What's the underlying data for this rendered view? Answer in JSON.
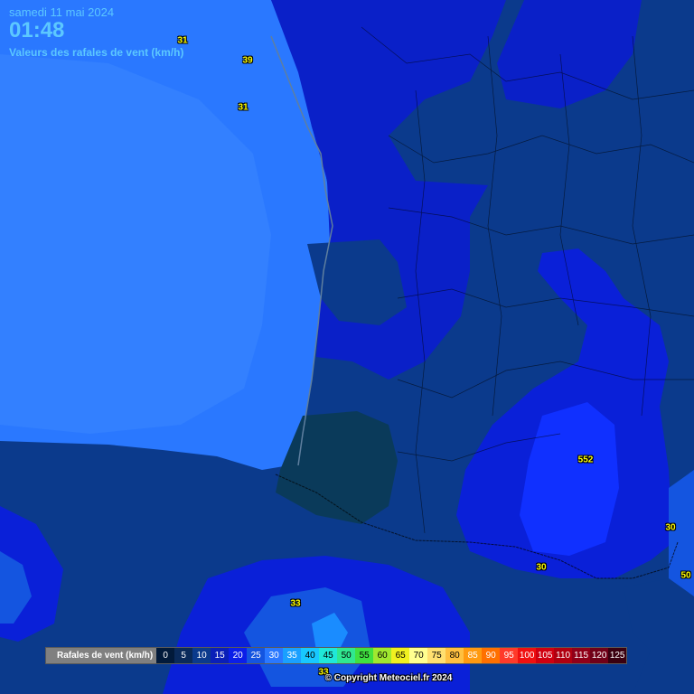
{
  "header": {
    "date": "samedi 11 mai 2024",
    "time": "01:48",
    "subtitle": "Valeurs des rafales de vent (km/h)"
  },
  "values": [
    {
      "text": "31",
      "pos": "coast-north"
    },
    {
      "text": "39",
      "pos": "coast-north-2"
    },
    {
      "text": "31",
      "pos": "coast-north-3"
    },
    {
      "text": "552",
      "pos": "cevennes"
    },
    {
      "text": "30",
      "pos": "east-coast"
    },
    {
      "text": "30",
      "pos": "pyrenees"
    },
    {
      "text": "50",
      "pos": "east-coast-2"
    },
    {
      "text": "33",
      "pos": "sea-south"
    },
    {
      "text": "33",
      "pos": "sea-south-2"
    }
  ],
  "legend": {
    "title": "Rafales de vent (km/h)",
    "steps": [
      {
        "label": "0",
        "bg": "#021a3a",
        "fg": "#ffffff"
      },
      {
        "label": "5",
        "bg": "#0a2a5a",
        "fg": "#ffffff"
      },
      {
        "label": "10",
        "bg": "#0b3a8c",
        "fg": "#ffffff"
      },
      {
        "label": "15",
        "bg": "#0a1fb8",
        "fg": "#ffffff"
      },
      {
        "label": "20",
        "bg": "#0b1ee8",
        "fg": "#ffffff"
      },
      {
        "label": "25",
        "bg": "#1455e0",
        "fg": "#ffffff"
      },
      {
        "label": "30",
        "bg": "#2a78ff",
        "fg": "#ffffff"
      },
      {
        "label": "35",
        "bg": "#1aa0ff",
        "fg": "#ffffff"
      },
      {
        "label": "40",
        "bg": "#18c8ff",
        "fg": "#000000"
      },
      {
        "label": "45",
        "bg": "#20e8d8",
        "fg": "#000000"
      },
      {
        "label": "50",
        "bg": "#30e890",
        "fg": "#000000"
      },
      {
        "label": "55",
        "bg": "#40e040",
        "fg": "#000000"
      },
      {
        "label": "60",
        "bg": "#a0e830",
        "fg": "#000000"
      },
      {
        "label": "65",
        "bg": "#f0f020",
        "fg": "#000000"
      },
      {
        "label": "70",
        "bg": "#ffff90",
        "fg": "#000000"
      },
      {
        "label": "75",
        "bg": "#ffe070",
        "fg": "#000000"
      },
      {
        "label": "80",
        "bg": "#ffc040",
        "fg": "#000000"
      },
      {
        "label": "85",
        "bg": "#ff9a10",
        "fg": "#ffffff"
      },
      {
        "label": "90",
        "bg": "#ff7000",
        "fg": "#ffffff"
      },
      {
        "label": "95",
        "bg": "#ff3a2a",
        "fg": "#ffffff"
      },
      {
        "label": "100",
        "bg": "#f01010",
        "fg": "#ffffff"
      },
      {
        "label": "105",
        "bg": "#d00010",
        "fg": "#ffffff"
      },
      {
        "label": "110",
        "bg": "#b00010",
        "fg": "#ffffff"
      },
      {
        "label": "115",
        "bg": "#900018",
        "fg": "#ffffff"
      },
      {
        "label": "120",
        "bg": "#700018",
        "fg": "#ffffff"
      },
      {
        "label": "125",
        "bg": "#3a0010",
        "fg": "#ffffff"
      }
    ]
  },
  "copyright": "© Copyright Meteociel.fr 2024"
}
